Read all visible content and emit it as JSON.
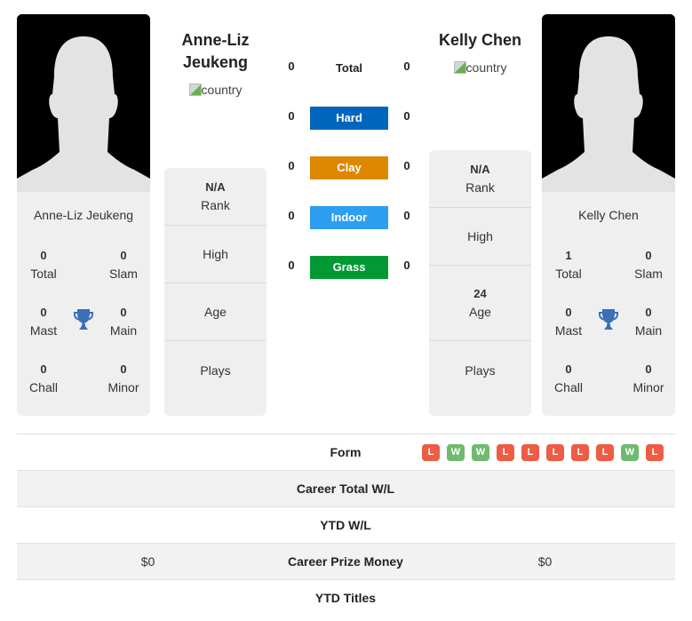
{
  "player1": {
    "name": "Anne-Liz Jeukeng",
    "title_line1": "Anne-Liz",
    "title_line2": "Jeukeng",
    "flag_alt": "country",
    "titles": {
      "total": {
        "value": "0",
        "label": "Total"
      },
      "slam": {
        "value": "0",
        "label": "Slam"
      },
      "mast": {
        "value": "0",
        "label": "Mast"
      },
      "main": {
        "value": "0",
        "label": "Main"
      },
      "chall": {
        "value": "0",
        "label": "Chall"
      },
      "minor": {
        "value": "0",
        "label": "Minor"
      }
    },
    "info": {
      "rank": {
        "value": "N/A",
        "label": "Rank"
      },
      "high": {
        "value": "",
        "label": "High"
      },
      "age": {
        "value": "",
        "label": "Age"
      },
      "plays": {
        "value": "",
        "label": "Plays"
      }
    }
  },
  "player2": {
    "name": "Kelly Chen",
    "title_line1": "Kelly Chen",
    "flag_alt": "country",
    "titles": {
      "total": {
        "value": "1",
        "label": "Total"
      },
      "slam": {
        "value": "0",
        "label": "Slam"
      },
      "mast": {
        "value": "0",
        "label": "Mast"
      },
      "main": {
        "value": "0",
        "label": "Main"
      },
      "chall": {
        "value": "0",
        "label": "Chall"
      },
      "minor": {
        "value": "0",
        "label": "Minor"
      }
    },
    "info": {
      "rank": {
        "value": "N/A",
        "label": "Rank"
      },
      "high": {
        "value": "",
        "label": "High"
      },
      "age": {
        "value": "24",
        "label": "Age"
      },
      "plays": {
        "value": "",
        "label": "Plays"
      }
    }
  },
  "h2h": {
    "total": {
      "label": "Total",
      "p1": "0",
      "p2": "0"
    },
    "surfaces": [
      {
        "label": "Hard",
        "p1": "0",
        "p2": "0",
        "color": "#0066bb"
      },
      {
        "label": "Clay",
        "p1": "0",
        "p2": "0",
        "color": "#dd8800"
      },
      {
        "label": "Indoor",
        "p1": "0",
        "p2": "0",
        "color": "#2d9ef0"
      },
      {
        "label": "Grass",
        "p1": "0",
        "p2": "0",
        "color": "#009933"
      }
    ]
  },
  "comparison": {
    "form": {
      "label": "Form",
      "results": [
        "L",
        "W",
        "W",
        "L",
        "L",
        "L",
        "L",
        "L",
        "W",
        "L"
      ]
    },
    "rows": [
      {
        "label": "Career Total W/L",
        "p1": "",
        "p2": ""
      },
      {
        "label": "YTD W/L",
        "p1": "",
        "p2": ""
      },
      {
        "label": "Career Prize Money",
        "p1": "$0",
        "p2": "$0"
      },
      {
        "label": "YTD Titles",
        "p1": "",
        "p2": ""
      }
    ]
  },
  "colors": {
    "win": "#6fba6f",
    "loss": "#ee5c43",
    "trophy": "#3a6fb8"
  }
}
